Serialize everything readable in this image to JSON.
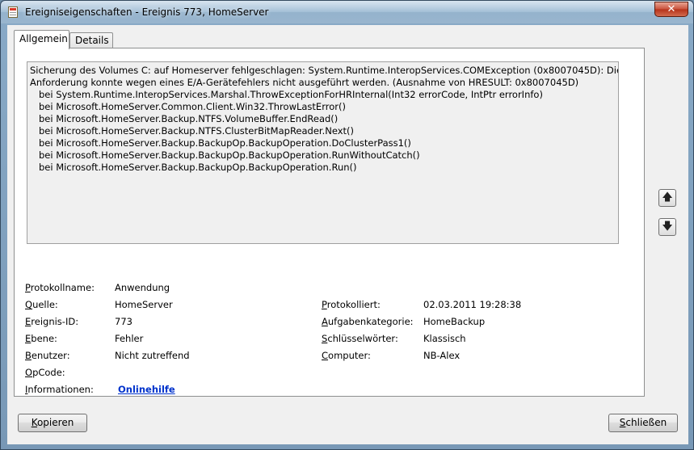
{
  "window": {
    "title": "Ereigniseigenschaften - Ereignis 773, HomeServer",
    "close_glyph": "✕",
    "app_icon": "event-log-icon"
  },
  "tabs": [
    {
      "label": "Allgemein",
      "active": true
    },
    {
      "label": "Details",
      "active": false
    }
  ],
  "description": "Sicherung des Volumes C: auf Homeserver fehlgeschlagen: System.Runtime.InteropServices.COMException (0x8007045D): Die\nAnforderung konnte wegen eines E/A-Gerätefehlers nicht ausgeführt werden. (Ausnahme von HRESULT: 0x8007045D)\n   bei System.Runtime.InteropServices.Marshal.ThrowExceptionForHRInternal(Int32 errorCode, IntPtr errorInfo)\n   bei Microsoft.HomeServer.Common.Client.Win32.ThrowLastError()\n   bei Microsoft.HomeServer.Backup.NTFS.VolumeBuffer.EndRead()\n   bei Microsoft.HomeServer.Backup.NTFS.ClusterBitMapReader.Next()\n   bei Microsoft.HomeServer.Backup.BackupOp.BackupOperation.DoClusterPass1()\n   bei Microsoft.HomeServer.Backup.BackupOp.BackupOperation.RunWithoutCatch()\n   bei Microsoft.HomeServer.Backup.BackupOp.BackupOperation.Run()",
  "properties": {
    "protokollname": {
      "label_first": "P",
      "label_rest": "rotokollname:",
      "value": "Anwendung"
    },
    "quelle": {
      "label_first": "Q",
      "label_rest": "uelle:",
      "value": "HomeServer"
    },
    "ereignis_id": {
      "label_first": "E",
      "label_rest": "reignis-ID:",
      "value": "773"
    },
    "ebene": {
      "label_first": "E",
      "label_rest": "bene:",
      "value": "Fehler"
    },
    "benutzer": {
      "label_first": "B",
      "label_rest": "enutzer:",
      "value": "Nicht zutreffend"
    },
    "opcode": {
      "label_first": "O",
      "label_rest": "pCode:",
      "value": ""
    },
    "informationen": {
      "label_first": "I",
      "label_rest": "nformationen:",
      "value": "Onlinehilfe"
    },
    "protokolliert": {
      "label_first": "P",
      "label_rest": "rotokolliert:",
      "value": "02.03.2011 19:28:38"
    },
    "aufgabenkategorie": {
      "label_first": "A",
      "label_rest": "ufgabenkategorie:",
      "value": "HomeBackup"
    },
    "schluesselwoerter": {
      "label_first": "S",
      "label_rest": "chlüsselwörter:",
      "value": "Klassisch"
    },
    "computer": {
      "label_first": "C",
      "label_rest": "omputer:",
      "value": "NB-Alex"
    }
  },
  "nav": {
    "up_glyph": "🡅",
    "down_glyph": "🡇",
    "up_icon": "arrow-up-icon",
    "down_icon": "arrow-down-icon"
  },
  "buttons": {
    "copy": {
      "first": "K",
      "rest": "opieren"
    },
    "close": {
      "first": "S",
      "rest": "chließen"
    }
  }
}
